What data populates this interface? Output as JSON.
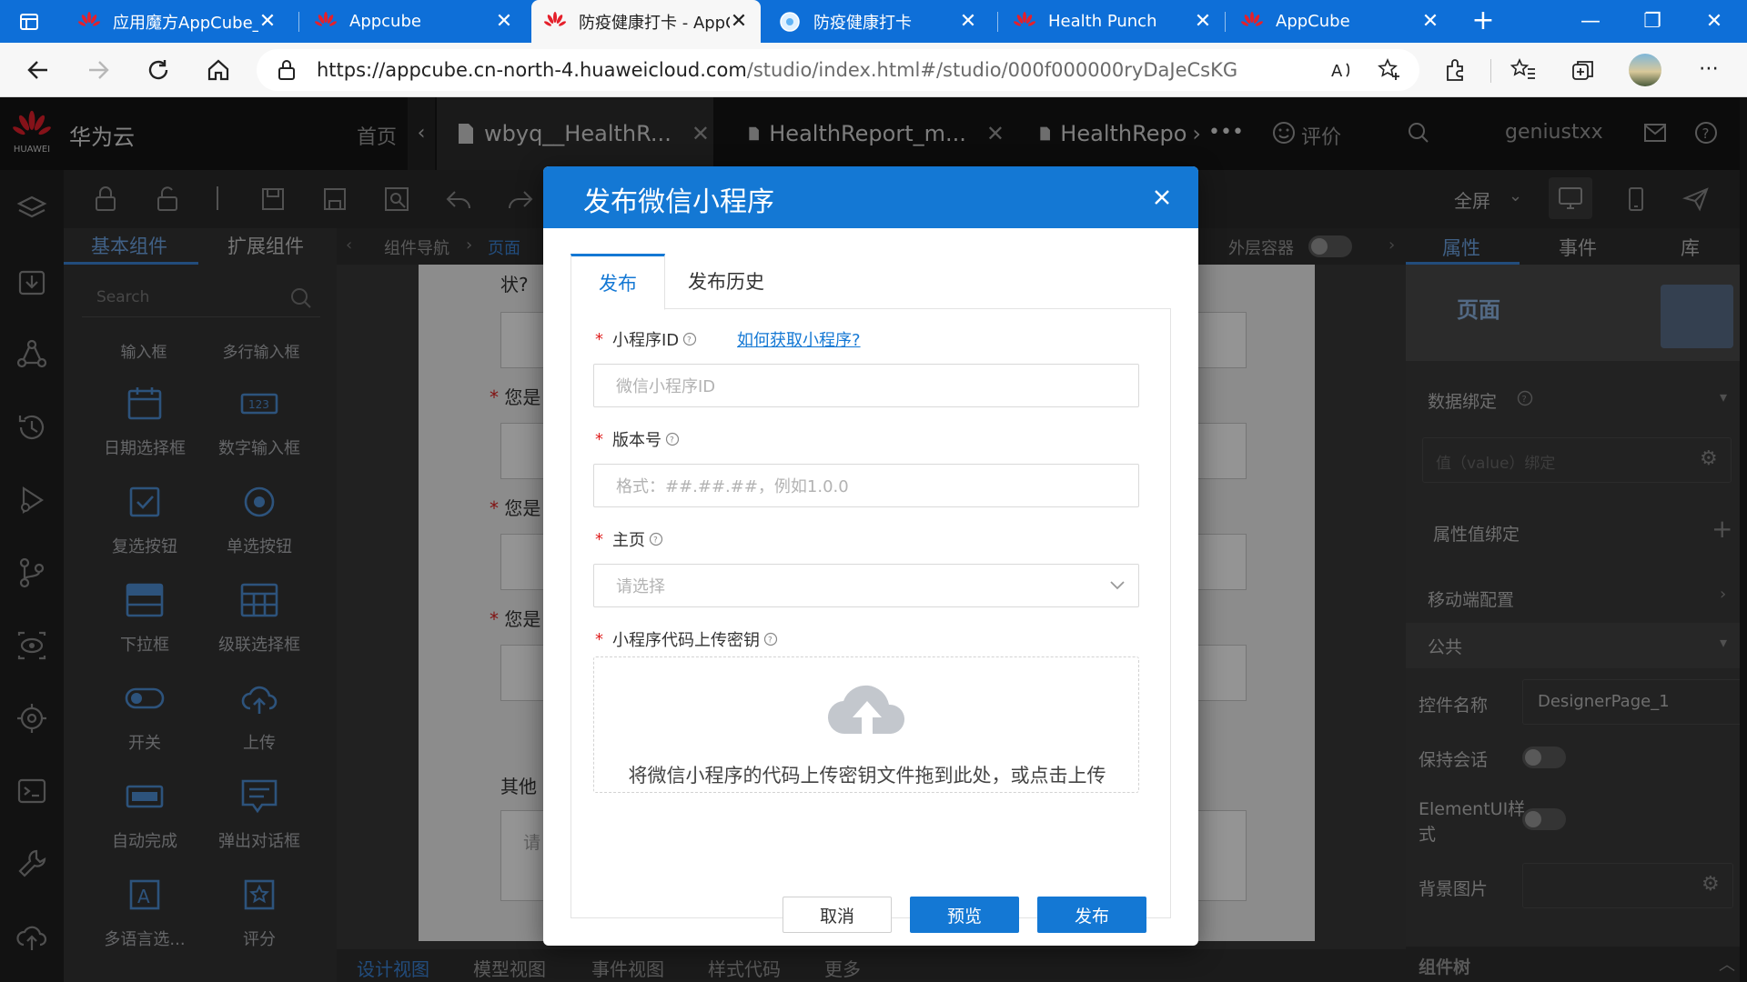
{
  "browser": {
    "tabs": [
      {
        "label": "应用魔方AppCube_",
        "active": false
      },
      {
        "label": "Appcube",
        "active": false
      },
      {
        "label": "防疫健康打卡 - AppCube",
        "active": true
      },
      {
        "label": "防疫健康打卡",
        "active": false
      },
      {
        "label": "Health Punch",
        "active": false
      },
      {
        "label": "AppCube",
        "active": false
      }
    ],
    "new_tab": "+",
    "url_host": "https://appcube.cn-north-4.huaweicloud.com",
    "url_path": "/studio/index.html#/studio/000f000000ryDaJeCsKG"
  },
  "app_header": {
    "brand_small": "HUAWEI",
    "brand": "华为云",
    "home": "首页",
    "doc_tabs": [
      "wbyq__HealthR...",
      "HealthReport_m...",
      "HealthRepo"
    ],
    "more": "•••",
    "rate": "评价",
    "username": "geniustxx"
  },
  "toolbar": {
    "fullscreen": "全屏"
  },
  "left_panel": {
    "tabs": [
      "基本组件",
      "扩展组件"
    ],
    "search_placeholder": "Search",
    "top_labels": [
      "输入框",
      "多行输入框"
    ],
    "components": [
      {
        "label": "日期选择框",
        "icon": "calendar-icon"
      },
      {
        "label": "数字输入框",
        "icon": "number-input-icon"
      },
      {
        "label": "复选按钮",
        "icon": "checkbox-icon"
      },
      {
        "label": "单选按钮",
        "icon": "radio-icon"
      },
      {
        "label": "下拉框",
        "icon": "dropdown-icon"
      },
      {
        "label": "级联选择框",
        "icon": "cascader-icon"
      },
      {
        "label": "开关",
        "icon": "switch-icon"
      },
      {
        "label": "上传",
        "icon": "upload-icon"
      },
      {
        "label": "自动完成",
        "icon": "autocomplete-icon"
      },
      {
        "label": "弹出对话框",
        "icon": "popup-dialog-icon"
      },
      {
        "label": "多语言选...",
        "icon": "multilang-icon"
      },
      {
        "label": "评分",
        "icon": "rating-icon"
      }
    ]
  },
  "canvas": {
    "breadcrumb_nav": "组件导航",
    "breadcrumb_page": "页面",
    "outer_container": "外层容器",
    "fragments": [
      "状?",
      "您是",
      "您是",
      "您是",
      "其他"
    ],
    "textarea_hint": "请",
    "bottom_tabs": [
      "设计视图",
      "模型视图",
      "事件视图",
      "样式代码",
      "更多"
    ]
  },
  "right_panel": {
    "tabs": [
      "属性",
      "事件",
      "库"
    ],
    "page_title": "页面",
    "data_binding": "数据绑定",
    "value_binding_placeholder": "值（value）绑定",
    "attr_binding": "属性值绑定",
    "mobile_config": "移动端配置",
    "public": "公共",
    "control_name_label": "控件名称",
    "control_name_value": "DesignerPage_1",
    "keep_session": "保持会话",
    "elementui_style_1": "ElementUI样",
    "elementui_style_2": "式",
    "background_image": "背景图片",
    "component_tree": "组件树"
  },
  "dialog": {
    "title": "发布微信小程序",
    "tabs": [
      "发布",
      "发布历史"
    ],
    "active_tab": 0,
    "fields": {
      "app_id_label": "小程序ID",
      "app_id_help_link": "如何获取小程序?",
      "app_id_placeholder": "微信小程序ID",
      "version_label": "版本号",
      "version_placeholder": "格式：##.##.##，例如1.0.0",
      "home_label": "主页",
      "home_placeholder": "请选择",
      "key_label": "小程序代码上传密钥",
      "upload_text": "将微信小程序的代码上传密钥文件拖到此处，或点击上传"
    },
    "buttons": {
      "cancel": "取消",
      "preview": "预览",
      "publish": "发布"
    }
  },
  "colors": {
    "primary": "#1478d4",
    "tab_strip": "#0e6fd8",
    "required": "#e02020"
  }
}
